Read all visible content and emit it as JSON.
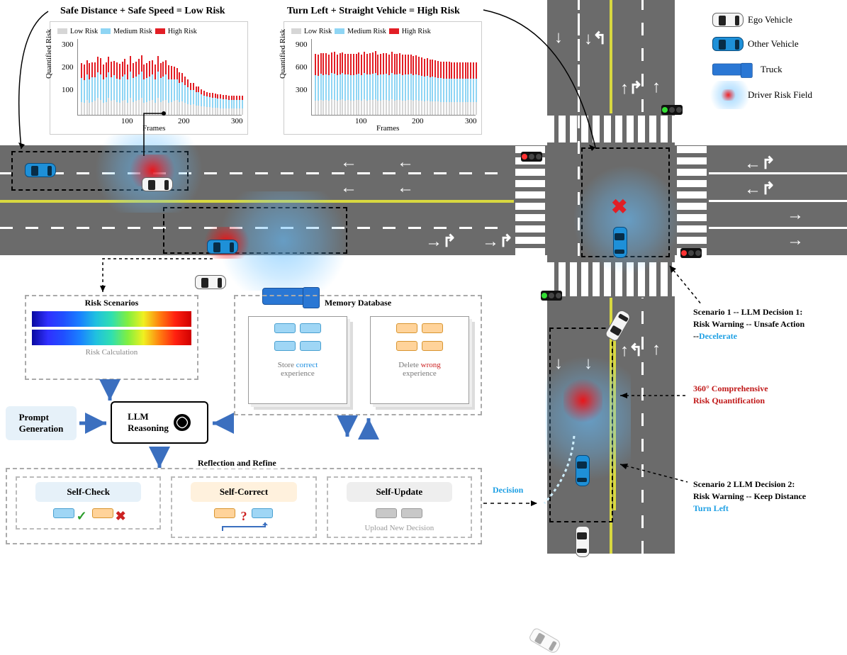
{
  "legend": {
    "ego": "Ego Vehicle",
    "other": "Other Vehicle",
    "truck": "Truck",
    "field": "Driver Risk Field"
  },
  "chart1": {
    "title": "Safe Distance + Safe Speed = Low Risk",
    "legend": {
      "low": "Low Risk",
      "med": "Medium Risk",
      "high": "High Risk"
    },
    "xlabel": "Frames",
    "ylabel": "Quantified Risk",
    "yticks": [
      "100",
      "200",
      "300"
    ],
    "xticks": [
      "100",
      "200",
      "300"
    ]
  },
  "chart2": {
    "title": "Turn Left + Straight Vehicle = High Risk",
    "legend": {
      "low": "Low Risk",
      "med": "Medium Risk",
      "high": "High Risk"
    },
    "xlabel": "Frames",
    "ylabel": "Quantified Risk",
    "yticks": [
      "300",
      "600",
      "900"
    ],
    "xticks": [
      "100",
      "200",
      "300"
    ]
  },
  "scenario1": {
    "line1": "Scenario 1 -- LLM Decision 1:",
    "line2": "Risk Warning -- Unsafe Action",
    "line3_prefix": "--",
    "line3_action": "Decelerate"
  },
  "scenario2": {
    "line1": "Scenario 2    LLM Decision 2:",
    "line2": "Risk Warning -- Keep Distance",
    "line3_prefix": "",
    "line3_action": "Turn Left"
  },
  "annot_360": "360° Comprehensive\nRisk Quantification",
  "flow": {
    "risk_title": "Risk Scenarios",
    "risk_calc": "Risk Calculation",
    "prompt": "Prompt\nGeneration",
    "llm": "LLM\nReasoning",
    "memdb": "Memory Database",
    "store_p1": "Store ",
    "store_p2": "correct",
    "store_p3": "\nexperience",
    "delete_p1": "Delete ",
    "delete_p2": "wrong",
    "delete_p3": "\nexperience",
    "refine": "Reflection and Refine",
    "selfcheck": "Self-Check",
    "selfcorrect": "Self-Correct",
    "selfupdate": "Self-Update",
    "upload": "Upload New Decision",
    "decision": "Decision"
  },
  "chart_data": [
    {
      "name": "chart1_safe_distance",
      "type": "stacked-bar",
      "title": "Safe Distance + Safe Speed = Low Risk",
      "xlabel": "Frames",
      "ylabel": "Quantified Risk",
      "xlim": [
        0,
        300
      ],
      "ylim": [
        0,
        350
      ],
      "x": [
        5,
        10,
        15,
        20,
        25,
        30,
        35,
        40,
        45,
        50,
        55,
        60,
        65,
        70,
        75,
        80,
        85,
        90,
        95,
        100,
        105,
        110,
        115,
        120,
        125,
        130,
        135,
        140,
        145,
        150,
        155,
        160,
        165,
        170,
        175,
        180,
        185,
        190,
        195,
        200,
        205,
        210,
        215,
        220,
        225,
        230,
        235,
        240,
        245,
        250,
        255,
        260,
        265,
        270,
        275,
        280,
        285,
        290,
        295,
        300
      ],
      "series": [
        {
          "name": "Low Risk",
          "color": "#d6d6d6",
          "values": [
            60,
            55,
            70,
            55,
            60,
            65,
            80,
            70,
            55,
            60,
            80,
            65,
            70,
            60,
            55,
            65,
            70,
            55,
            80,
            60,
            65,
            70,
            80,
            55,
            60,
            65,
            70,
            55,
            80,
            60,
            65,
            70,
            55,
            60,
            65,
            70,
            58,
            62,
            55,
            50,
            45,
            48,
            42,
            44,
            40,
            38,
            36,
            35,
            34,
            33,
            32,
            31,
            30,
            30,
            30,
            30,
            30,
            30,
            30,
            30
          ]
        },
        {
          "name": "Medium Risk",
          "color": "#8fd5f4",
          "values": [
            110,
            105,
            115,
            110,
            112,
            108,
            115,
            118,
            108,
            112,
            115,
            110,
            112,
            108,
            110,
            112,
            115,
            108,
            118,
            110,
            112,
            115,
            120,
            108,
            110,
            112,
            115,
            108,
            118,
            110,
            112,
            115,
            108,
            105,
            100,
            95,
            90,
            88,
            82,
            78,
            70,
            68,
            62,
            60,
            55,
            52,
            50,
            48,
            46,
            45,
            44,
            43,
            42,
            41,
            40,
            40,
            40,
            40,
            40,
            40
          ]
        },
        {
          "name": "High Risk",
          "color": "#e21e25",
          "values": [
            70,
            72,
            68,
            75,
            70,
            68,
            72,
            74,
            68,
            70,
            72,
            70,
            68,
            74,
            70,
            68,
            72,
            70,
            74,
            68,
            70,
            72,
            74,
            68,
            70,
            72,
            68,
            70,
            72,
            68,
            70,
            68,
            65,
            60,
            58,
            52,
            48,
            44,
            40,
            36,
            32,
            30,
            28,
            26,
            24,
            22,
            20,
            20,
            20,
            20,
            20,
            20,
            20,
            20,
            20,
            20,
            20,
            20,
            20,
            20
          ]
        }
      ]
    },
    {
      "name": "chart2_turn_left",
      "type": "stacked-bar",
      "title": "Turn Left + Straight Vehicle = High Risk",
      "xlabel": "Frames",
      "ylabel": "Quantified Risk",
      "xlim": [
        0,
        300
      ],
      "ylim": [
        0,
        950
      ],
      "x": [
        5,
        10,
        15,
        20,
        25,
        30,
        35,
        40,
        45,
        50,
        55,
        60,
        65,
        70,
        75,
        80,
        85,
        90,
        95,
        100,
        105,
        110,
        115,
        120,
        125,
        130,
        135,
        140,
        145,
        150,
        155,
        160,
        165,
        170,
        175,
        180,
        185,
        190,
        195,
        200,
        205,
        210,
        215,
        220,
        225,
        230,
        235,
        240,
        245,
        250,
        255,
        260,
        265,
        270,
        275,
        280,
        285,
        290,
        295,
        300
      ],
      "series": [
        {
          "name": "Low Risk",
          "color": "#d6d6d6",
          "values": [
            180,
            175,
            190,
            180,
            185,
            178,
            195,
            188,
            180,
            185,
            195,
            182,
            188,
            180,
            178,
            185,
            190,
            178,
            198,
            182,
            185,
            190,
            198,
            180,
            182,
            185,
            190,
            178,
            195,
            182,
            185,
            190,
            178,
            182,
            185,
            190,
            182,
            186,
            178,
            175,
            172,
            175,
            170,
            172,
            168,
            166,
            164,
            163,
            162,
            161,
            160,
            160,
            160,
            160,
            160,
            160,
            160,
            160,
            160,
            160
          ]
        },
        {
          "name": "Medium Risk",
          "color": "#8fd5f4",
          "values": [
            320,
            315,
            325,
            320,
            322,
            318,
            325,
            328,
            318,
            322,
            325,
            320,
            322,
            318,
            320,
            322,
            325,
            318,
            328,
            320,
            322,
            325,
            330,
            318,
            320,
            322,
            325,
            318,
            328,
            320,
            322,
            325,
            318,
            320,
            322,
            325,
            318,
            322,
            318,
            315,
            310,
            312,
            305,
            308,
            300,
            298,
            295,
            293,
            292,
            291,
            290,
            290,
            290,
            290,
            290,
            290,
            290,
            290,
            290,
            290
          ]
        },
        {
          "name": "High Risk",
          "color": "#e21e25",
          "values": [
            260,
            265,
            258,
            270,
            262,
            258,
            266,
            270,
            258,
            262,
            266,
            262,
            258,
            268,
            262,
            258,
            264,
            260,
            268,
            258,
            262,
            265,
            270,
            258,
            260,
            262,
            258,
            260,
            264,
            258,
            260,
            258,
            255,
            250,
            248,
            242,
            238,
            234,
            230,
            226,
            222,
            220,
            218,
            216,
            214,
            212,
            210,
            210,
            210,
            210,
            210,
            210,
            210,
            210,
            210,
            210,
            210,
            210,
            210,
            210
          ]
        }
      ]
    }
  ]
}
